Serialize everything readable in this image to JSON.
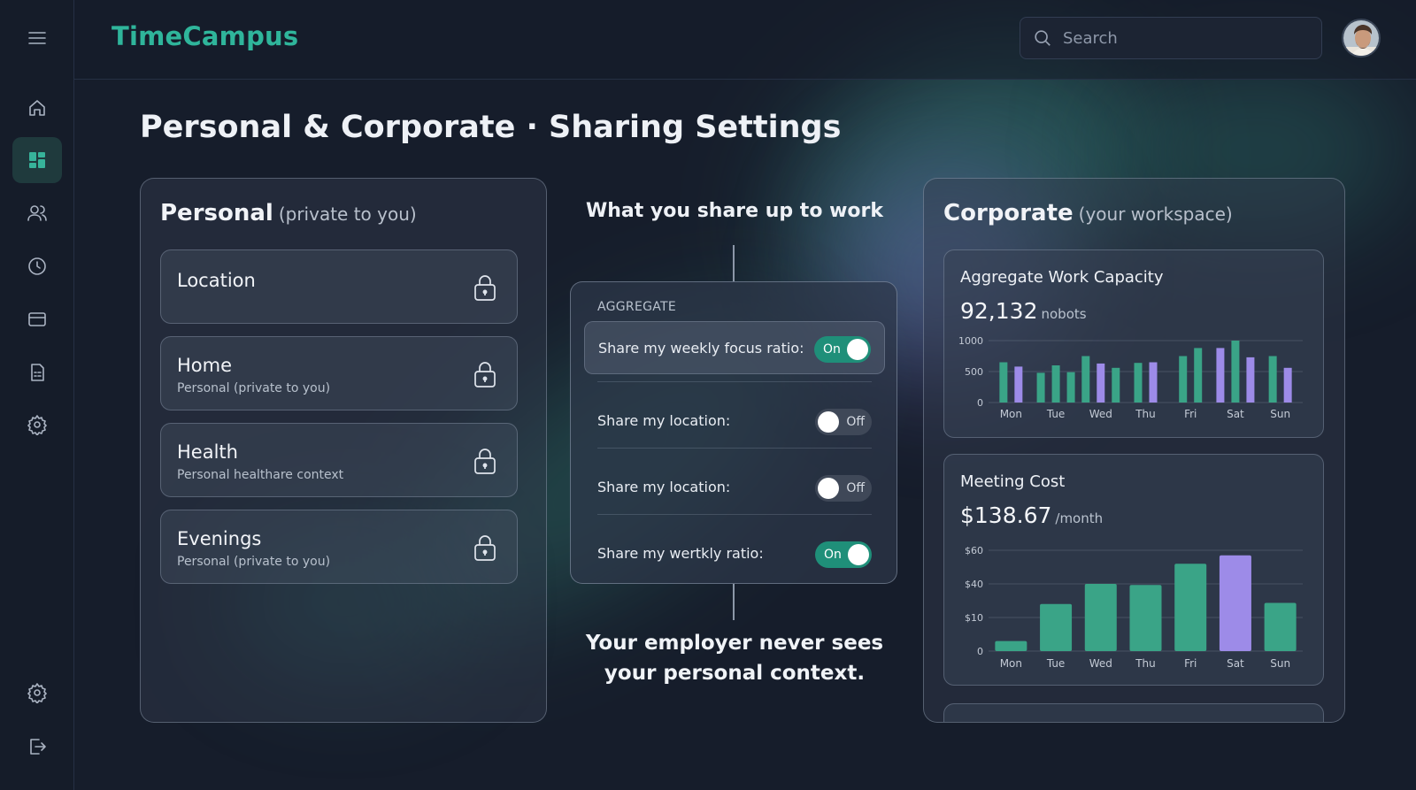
{
  "app": {
    "brand": "TimeCampus",
    "search_placeholder": "Search"
  },
  "sidebar": {
    "items": [
      {
        "name": "menu-icon",
        "active": false
      },
      {
        "name": "home-icon",
        "active": false
      },
      {
        "name": "dashboard-icon",
        "active": true
      },
      {
        "name": "users-icon",
        "active": false
      },
      {
        "name": "clock-icon",
        "active": false
      },
      {
        "name": "wallet-icon",
        "active": false
      },
      {
        "name": "report-icon",
        "active": false
      },
      {
        "name": "gear-icon",
        "active": false
      },
      {
        "name": "settings-icon",
        "active": false
      },
      {
        "name": "logout-icon",
        "active": false
      }
    ]
  },
  "page": {
    "title": "Personal & Corporate · Sharing Settings"
  },
  "personal": {
    "title": "Personal",
    "subtitle": "(private to you)",
    "items": [
      {
        "title": "Location",
        "subtitle": ""
      },
      {
        "title": "Home",
        "subtitle": "Personal (private to you)"
      },
      {
        "title": "Health",
        "subtitle": "Personal healthare context"
      },
      {
        "title": "Evenings",
        "subtitle": "Personal (private to you)"
      }
    ]
  },
  "sharing": {
    "heading": "What you share up to work",
    "section_label": "AGGREGATE",
    "rows": [
      {
        "label": "Share my weekly focus ratio:",
        "state": "On"
      },
      {
        "label": "Share my location:",
        "state": "Off"
      },
      {
        "label": "Share my location:",
        "state": "Off"
      },
      {
        "label": "Share my wertkly ratio:",
        "state": "On"
      }
    ],
    "footer_line1": "Your employer never sees",
    "footer_line2": "your personal context."
  },
  "corporate": {
    "title": "Corporate",
    "subtitle": "(your workspace)",
    "capacity": {
      "title": "Aggregate Work Capacity",
      "value": "92,132",
      "unit": "nobots"
    },
    "meeting": {
      "title": "Meeting Cost",
      "value": "$138.67",
      "unit": "/month"
    }
  },
  "colors": {
    "accent": "#2fb59b",
    "bar_green": "#3aa487",
    "bar_purple": "#9d8be8",
    "background": "#161d2b"
  },
  "chart_data": [
    {
      "type": "bar",
      "title": "Aggregate Work Capacity",
      "categories": [
        "Mon",
        "Tue",
        "Wed",
        "Thu",
        "Fri",
        "Sat",
        "Sun"
      ],
      "ytick_labels": [
        "0",
        "500",
        "1000"
      ],
      "ylim": [
        0,
        1000
      ],
      "series": [
        {
          "values": [
            [
              650,
              580
            ],
            [
              480,
              600,
              490
            ],
            [
              750,
              630,
              560
            ],
            [
              640,
              650
            ],
            [
              750,
              880
            ],
            [
              880,
              1000,
              730
            ],
            [
              750,
              560
            ]
          ]
        }
      ],
      "bar_colors": [
        [
          "#3aa487",
          "#9d8be8"
        ],
        [
          "#3aa487",
          "#3aa487",
          "#3aa487"
        ],
        [
          "#3aa487",
          "#9d8be8",
          "#3aa487"
        ],
        [
          "#3aa487",
          "#9d8be8"
        ],
        [
          "#3aa487",
          "#3aa487"
        ],
        [
          "#9d8be8",
          "#3aa487",
          "#9d8be8"
        ],
        [
          "#3aa487",
          "#9d8be8"
        ]
      ],
      "grid": true
    },
    {
      "type": "bar",
      "title": "Meeting Cost",
      "categories": [
        "Mon",
        "Tue",
        "Wed",
        "Thu",
        "Fri",
        "Sat",
        "Sun"
      ],
      "ytick_labels": [
        "0",
        "$10",
        "$40",
        "$60"
      ],
      "values": [
        3,
        22,
        40,
        39,
        52,
        57,
        23
      ],
      "bar_colors": [
        "#3aa487",
        "#3aa487",
        "#3aa487",
        "#3aa487",
        "#3aa487",
        "#9d8be8",
        "#3aa487"
      ],
      "grid": true
    }
  ]
}
